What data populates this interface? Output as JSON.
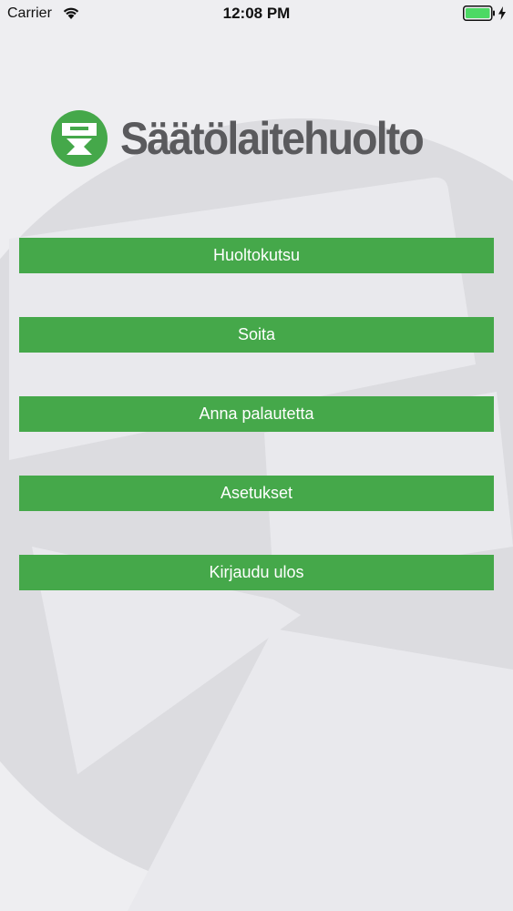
{
  "status_bar": {
    "carrier": "Carrier",
    "time": "12:08 PM",
    "battery_color": "#4cd964"
  },
  "logo": {
    "text": "Säätölaitehuolto",
    "brand_color": "#45a84a",
    "text_color": "#5a5a5d"
  },
  "menu": {
    "items": [
      {
        "label": "Huoltokutsu"
      },
      {
        "label": "Soita"
      },
      {
        "label": "Anna palautetta"
      },
      {
        "label": "Asetukset"
      },
      {
        "label": "Kirjaudu ulos"
      }
    ]
  },
  "colors": {
    "background": "#eeeef1",
    "button": "#45a84a",
    "button_text": "#ffffff"
  }
}
